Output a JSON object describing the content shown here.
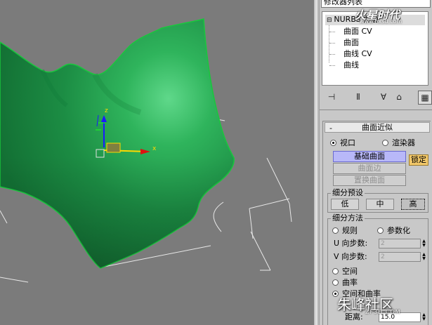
{
  "viewport": {
    "axis_x_label": "x",
    "axis_z_label": "z"
  },
  "modifier_stack": {
    "header": "修改器列表",
    "root": "NURBS 曲面",
    "items": [
      "曲面 CV",
      "曲面",
      "曲线 CV",
      "曲线"
    ]
  },
  "toolbar_icons": [
    "pin-stack-icon",
    "show-end-result-icon",
    "make-unique-icon",
    "remove-modifier-icon",
    "configure-sets-icon"
  ],
  "rollout": {
    "title": "曲面近似",
    "target": {
      "viewport_label": "视口",
      "renderer_label": "渲染器",
      "selected": "视口"
    },
    "buttons": {
      "base_surface": "基础曲面",
      "surface_edge": "曲面边",
      "displaced_surface": "置换曲面",
      "lock": "锁定"
    },
    "presets": {
      "title": "细分预设",
      "low": "低",
      "medium": "中",
      "high": "高",
      "selected": "高"
    },
    "method": {
      "title": "细分方法",
      "regular_label": "规则",
      "parametric_label": "参数化",
      "u_steps_label": "U 向步数:",
      "u_steps_value": "2",
      "v_steps_label": "V 向步数:",
      "v_steps_value": "2",
      "spatial_label": "空间",
      "curvature_label": "曲率",
      "spatial_curvature_label": "空间和曲率",
      "distance_label": "距离:",
      "distance_value": "15.0",
      "selected": "空间和曲率"
    }
  },
  "watermarks": {
    "top_brand": "火星时代",
    "top_url": "www.hxsd.com",
    "bottom_brand": "朱峰社区",
    "bottom_url": "ZF3D.COM"
  },
  "colors": {
    "surface_green": "#1f9a4a",
    "surface_highlight": "#4fd07c",
    "viewport_bg": "#7b7b7b",
    "panel_bg": "#c8c8c8",
    "active_button": "#b8b8f8",
    "lock_button": "#f2c86a"
  }
}
